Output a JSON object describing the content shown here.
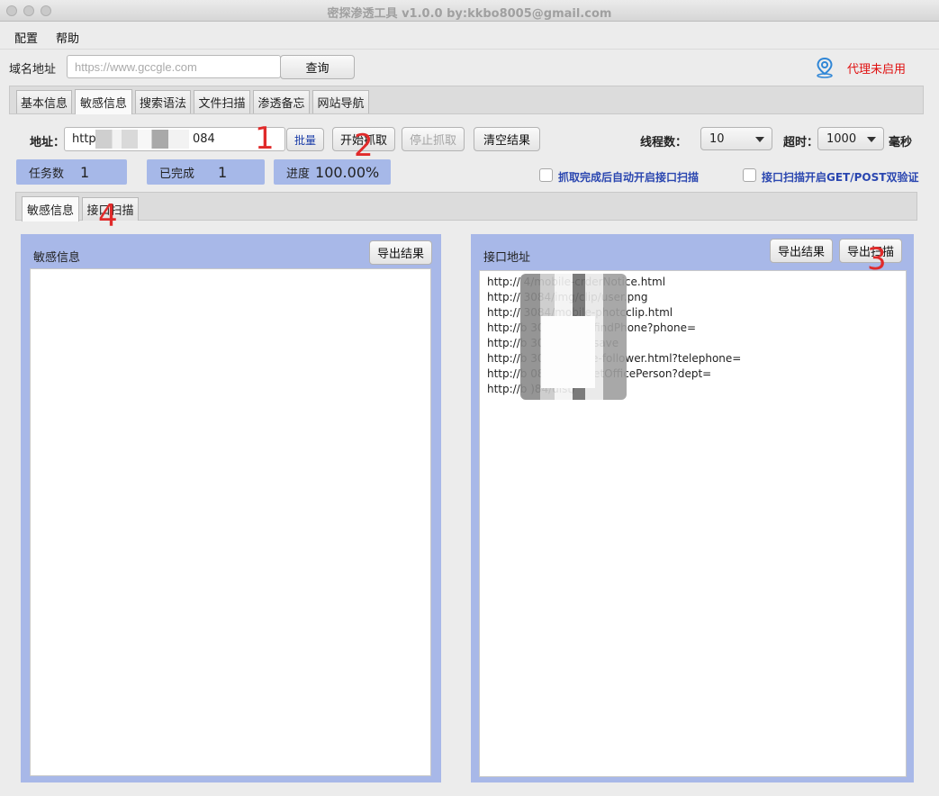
{
  "window": {
    "title": "密探渗透工具  v1.0.0 by:kkbo8005@gmail.com"
  },
  "menu": [
    "配置",
    "帮助"
  ],
  "domain_row": {
    "label": "域名地址",
    "placeholder": "https://www.gccgle.com",
    "query_button": "查询",
    "proxy_status": "代理未启用",
    "proxy_icon": "location-pin-icon"
  },
  "main_tabs": [
    "基本信息",
    "敏感信息",
    "搜索语法",
    "文件扫描",
    "渗透备忘",
    "网站导航"
  ],
  "main_tabs_active": 1,
  "controls": {
    "address_label": "地址：",
    "address_value_prefix": "http",
    "address_value_suffix": "084",
    "batch_button": "批量",
    "start_button": "开始抓取",
    "stop_button": "停止抓取",
    "clear_button": "清空结果",
    "threads_label": "线程数：",
    "threads_value": "10",
    "timeout_label": "超时：",
    "timeout_value": "1000",
    "timeout_unit": "毫秒"
  },
  "stats": {
    "tasks_label": "任务数",
    "tasks_value": "1",
    "done_label": "已完成",
    "done_value": "1",
    "progress_label": "进度",
    "progress_value": "100.00%"
  },
  "options": {
    "auto_scan_label": "抓取完成后自动开启接口扫描",
    "dual_verify_label": "接口扫描开启GET/POST双验证"
  },
  "sub_tabs": [
    "敏感信息",
    "接口扫描"
  ],
  "sub_tabs_active": 0,
  "left_panel": {
    "title": "敏感信息",
    "export_button": "导出结果"
  },
  "right_panel": {
    "title": "接口地址",
    "export_button": "导出结果",
    "scan_button": "导出扫描",
    "urls": [
      "http://                              4/mobile-crderNotice.html",
      "http://                              3084/img/clip/user.png",
      "http://                              3084/mobile-photcclip.html",
      "http://b                             3084/crder/findPhone?phone=",
      "http://b                             3084/crder/save",
      "http://b                             3084/mobile-follower.html?telephone=",
      "http://b                             084/crder/getOfficePerson?dept=",
      "http://b                             )84/dist/"
    ]
  },
  "annotations": [
    "1",
    "2",
    "3",
    "4"
  ],
  "colors": {
    "panel_blue": "#a8b8e8",
    "proxy_red": "#e01010",
    "option_blue": "#2a46b0",
    "annotation_red": "#e02a2a"
  }
}
